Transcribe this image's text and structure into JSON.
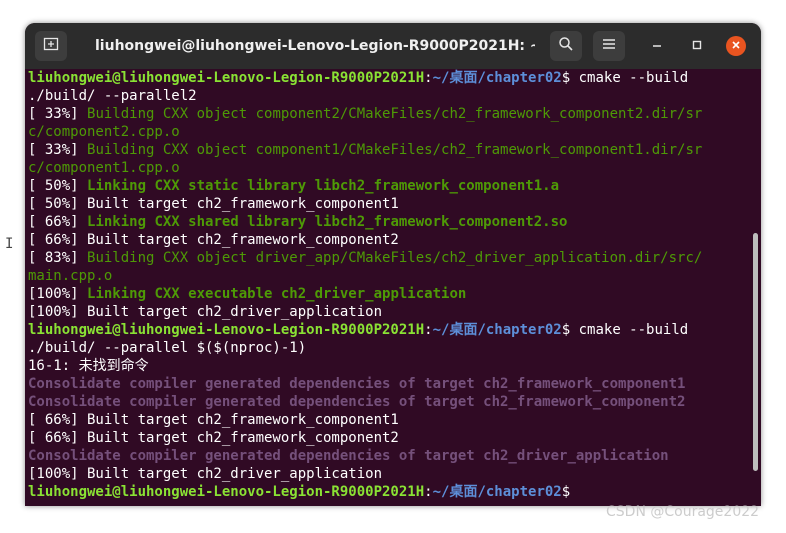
{
  "window": {
    "title": "liuhongwei@liuhongwei-Lenovo-Legion-R9000P2021H: ~/桌...",
    "new_tab_icon": "new-tab-icon",
    "search_icon": "search-icon",
    "menu_icon": "hamburger-menu-icon"
  },
  "colors": {
    "terminal_bg": "#300a24",
    "titlebar_bg": "#2c2c2c",
    "prompt_user": "#8ae234",
    "prompt_path": "#5d8fd9",
    "building": "#4e9a06",
    "consolidate": "#75507b",
    "close_button": "#e95420"
  },
  "terminal": {
    "lines": [
      {
        "segments": [
          {
            "text": "liuhongwei@liuhongwei-Lenovo-Legion-R9000P2021H",
            "style": "pg"
          },
          {
            "text": ":",
            "style": ""
          },
          {
            "text": "~/桌面/chapter02",
            "style": "pb"
          },
          {
            "text": "$ cmake --build",
            "style": ""
          }
        ]
      },
      {
        "segments": [
          {
            "text": "./build/ --parallel2",
            "style": ""
          }
        ]
      },
      {
        "segments": [
          {
            "text": "[ 33%] ",
            "style": ""
          },
          {
            "text": "Building CXX object component2/CMakeFiles/ch2_framework_component2.dir/sr",
            "style": "gr"
          }
        ]
      },
      {
        "segments": [
          {
            "text": "c/component2.cpp.o",
            "style": "gr"
          }
        ]
      },
      {
        "segments": [
          {
            "text": "[ 33%] ",
            "style": ""
          },
          {
            "text": "Building CXX object component1/CMakeFiles/ch2_framework_component1.dir/sr",
            "style": "gr"
          }
        ]
      },
      {
        "segments": [
          {
            "text": "c/component1.cpp.o",
            "style": "gr"
          }
        ]
      },
      {
        "segments": [
          {
            "text": "[ 50%] ",
            "style": ""
          },
          {
            "text": "Linking CXX static library libch2_framework_component1.a",
            "style": "gb"
          }
        ]
      },
      {
        "segments": [
          {
            "text": "[ 50%] Built target ch2_framework_component1",
            "style": ""
          }
        ]
      },
      {
        "segments": [
          {
            "text": "[ 66%] ",
            "style": ""
          },
          {
            "text": "Linking CXX shared library libch2_framework_component2.so",
            "style": "gb"
          }
        ]
      },
      {
        "segments": [
          {
            "text": "[ 66%] Built target ch2_framework_component2",
            "style": ""
          }
        ]
      },
      {
        "segments": [
          {
            "text": "[ 83%] ",
            "style": ""
          },
          {
            "text": "Building CXX object driver_app/CMakeFiles/ch2_driver_application.dir/src/",
            "style": "gr"
          }
        ]
      },
      {
        "segments": [
          {
            "text": "main.cpp.o",
            "style": "gr"
          }
        ]
      },
      {
        "segments": [
          {
            "text": "[100%] ",
            "style": ""
          },
          {
            "text": "Linking CXX executable ch2_driver_application",
            "style": "gb"
          }
        ]
      },
      {
        "segments": [
          {
            "text": "[100%] Built target ch2_driver_application",
            "style": ""
          }
        ]
      },
      {
        "segments": [
          {
            "text": "liuhongwei@liuhongwei-Lenovo-Legion-R9000P2021H",
            "style": "pg"
          },
          {
            "text": ":",
            "style": ""
          },
          {
            "text": "~/桌面/chapter02",
            "style": "pb"
          },
          {
            "text": "$ cmake --build",
            "style": ""
          }
        ]
      },
      {
        "segments": [
          {
            "text": "./build/ --parallel $($(nproc)-1)",
            "style": ""
          }
        ]
      },
      {
        "segments": [
          {
            "text": "16-1: 未找到命令",
            "style": ""
          }
        ]
      },
      {
        "segments": [
          {
            "text": "Consolidate compiler generated dependencies of target ch2_framework_component1",
            "style": "pu"
          }
        ]
      },
      {
        "segments": [
          {
            "text": "Consolidate compiler generated dependencies of target ch2_framework_component2",
            "style": "pu"
          }
        ]
      },
      {
        "segments": [
          {
            "text": "[ 66%] Built target ch2_framework_component1",
            "style": ""
          }
        ]
      },
      {
        "segments": [
          {
            "text": "[ 66%] Built target ch2_framework_component2",
            "style": ""
          }
        ]
      },
      {
        "segments": [
          {
            "text": "Consolidate compiler generated dependencies of target ch2_driver_application",
            "style": "pu"
          }
        ]
      },
      {
        "segments": [
          {
            "text": "[100%] Built target ch2_driver_application",
            "style": ""
          }
        ]
      },
      {
        "segments": [
          {
            "text": "liuhongwei@liuhongwei-Lenovo-Legion-R9000P2021H",
            "style": "pg"
          },
          {
            "text": ":",
            "style": ""
          },
          {
            "text": "~/桌面/chapter02",
            "style": "pb"
          },
          {
            "text": "$ ",
            "style": ""
          }
        ]
      }
    ]
  },
  "watermark": "CSDN @Courage2022"
}
